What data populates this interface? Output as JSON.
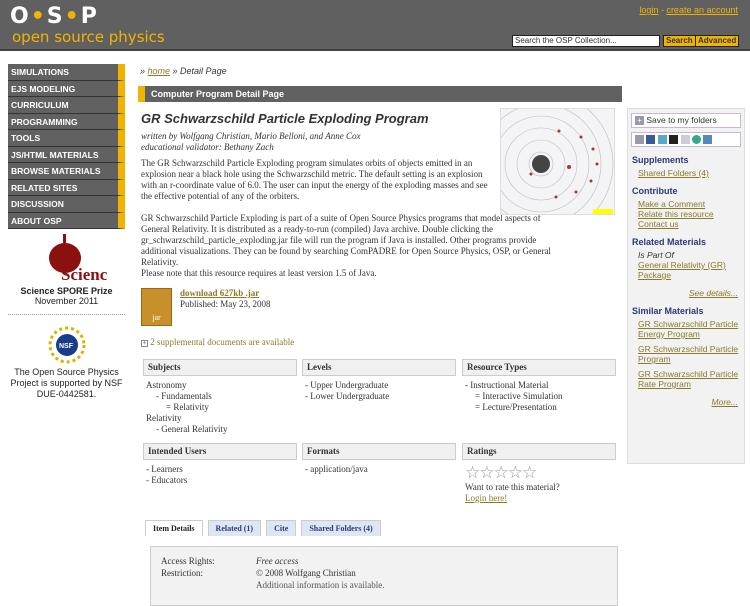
{
  "header": {
    "logo_top": "O·S·P",
    "logo_sub": "open source physics",
    "login": "login",
    "create_account": "create an account",
    "search_placeholder": "Search the OSP Collection...",
    "search_button": "Search",
    "advanced_button": "Advanced"
  },
  "nav": [
    "SIMULATIONS",
    "EJS MODELING",
    "CURRICULUM",
    "PROGRAMMING",
    "TOOLS",
    "JS/HTML MATERIALS",
    "BROWSE MATERIALS",
    "RELATED SITES",
    "DISCUSSION",
    "ABOUT OSP"
  ],
  "prize": {
    "logo": "Science",
    "title": "Science SPORE Prize",
    "date": "November 2011"
  },
  "nsf": {
    "logo": "NSF",
    "text": "The Open Source Physics Project is supported by NSF DUE-0442581."
  },
  "breadcrumb": {
    "home": "home",
    "current": "Detail Page"
  },
  "section_title": "Computer Program Detail Page",
  "resource": {
    "title": "GR Schwarzschild Particle Exploding Program",
    "authors": "written by Wolfgang Christian, Mario Belloni, and Anne Cox",
    "validator": "educational validator: Bethany Zach",
    "desc1": "The GR Schwarzschild Particle Exploding program simulates orbits of objects emitted in an explosion near a black hole using the Schwarzschild metric. The default setting is an explosion with an r-coordinate value of 6.0. The user can input the energy of the exploding masses and see the effective potential of any of the orbiters.",
    "desc2": "GR Schwarzschild Particle Exploding is part of a suite of Open Source Physics programs that model aspects of General Relativity. It is distributed as a ready-to-run (compiled) Java archive. Double clicking the gr_schwarzschild_particle_exploding.jar file will run the program if Java is installed. Other programs provide additional visualizations.  They can be found by searching ComPADRE for Open Source Physics, OSP, or General Relativity.",
    "note": "Please note that this resource requires at least version 1.5 of Java.",
    "jar_label": "jar",
    "download": "download 627kb .jar",
    "published": "Published: May 23, 2008",
    "supplemental": "2 supplemental documents are available"
  },
  "table": {
    "subjects": {
      "header": "Subjects",
      "items": [
        "Astronomy",
        "- Fundamentals",
        "= Relativity",
        "Relativity",
        "- General Relativity"
      ]
    },
    "levels": {
      "header": "Levels",
      "items": [
        "- Upper Undergraduate",
        "- Lower Undergraduate"
      ]
    },
    "types": {
      "header": "Resource Types",
      "items": [
        "- Instructional Material",
        "= Interactive Simulation",
        "= Lecture/Presentation"
      ]
    },
    "users": {
      "header": "Intended Users",
      "items": [
        "- Learners",
        "- Educators"
      ]
    },
    "formats": {
      "header": "Formats",
      "items": [
        "- application/java"
      ]
    },
    "ratings": {
      "header": "Ratings",
      "stars": 0,
      "max": 5,
      "prompt": "Want to rate this material?",
      "login": "Login here!"
    }
  },
  "tabs": [
    "Item Details",
    "Related (1)",
    "Cite",
    "Shared Folders (4)"
  ],
  "details": {
    "access_label": "Access Rights:",
    "access": "Free access",
    "restriction_label": "Restriction:",
    "restriction": "© 2008 Wolfgang Christian",
    "additional": "Additional information is available."
  },
  "sidebar": {
    "save": "Save to my folders",
    "supplements": "Supplements",
    "shared": "Shared Folders (4)",
    "contribute": "Contribute",
    "comment": "Make a Comment",
    "relate": "Relate this resource",
    "contact": "Contact us",
    "related": "Related Materials",
    "is_part_of": "Is Part Of",
    "package": "General Relativity (GR) Package",
    "see_details": "See details...",
    "similar": "Similar Materials",
    "sim": [
      "GR Schwarzschild Particle Energy Program",
      "GR Schwarzschild Particle Program",
      "GR Schwarzschild Particle Rate Program"
    ],
    "more": "More..."
  }
}
